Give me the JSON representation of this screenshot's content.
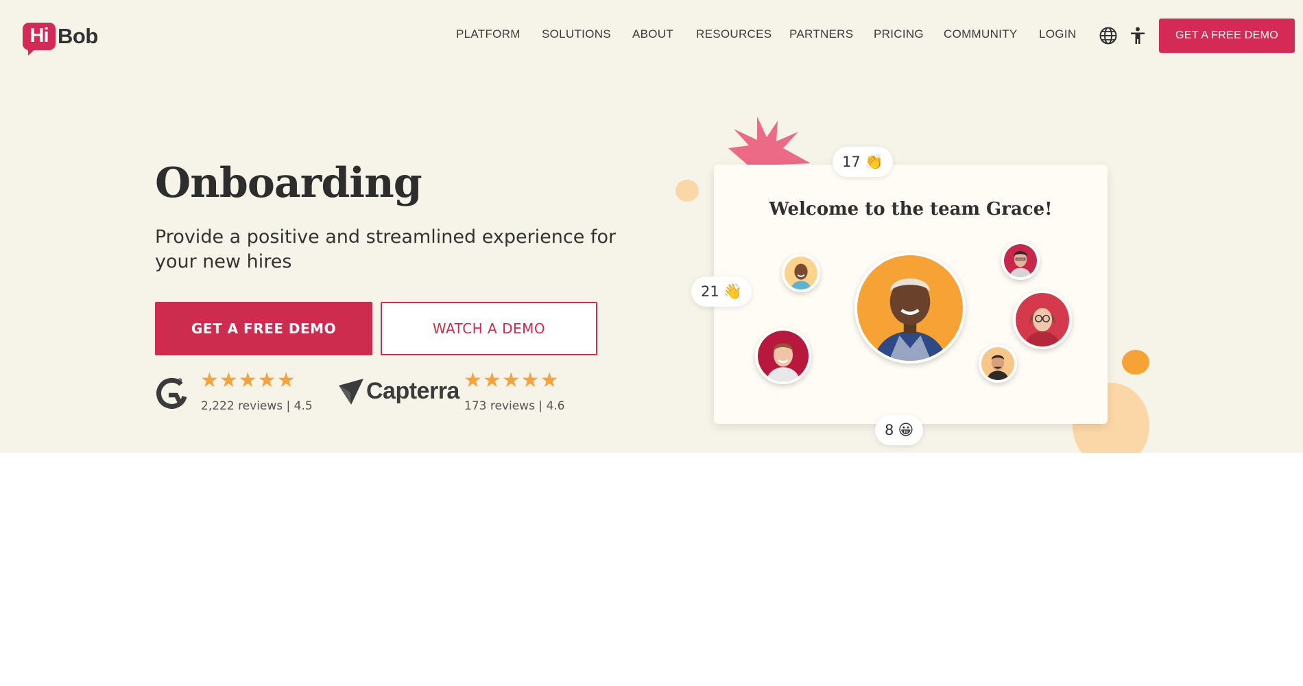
{
  "brand": {
    "logo_hi": "Hi",
    "logo_bob": "Bob"
  },
  "nav": {
    "items": [
      {
        "label": "PLATFORM",
        "name": "nav-platform"
      },
      {
        "label": "SOLUTIONS",
        "name": "nav-solutions"
      },
      {
        "label": "ABOUT",
        "name": "nav-about"
      },
      {
        "label": "RESOURCES",
        "name": "nav-resources"
      },
      {
        "label": "PARTNERS",
        "name": "nav-partners"
      },
      {
        "label": "PRICING",
        "name": "nav-pricing"
      },
      {
        "label": "COMMUNITY",
        "name": "nav-community"
      },
      {
        "label": "LOGIN",
        "name": "nav-login"
      }
    ],
    "icons": [
      "globe-icon",
      "accessibility-icon"
    ],
    "cta_label": "GET A FREE DEMO"
  },
  "hero": {
    "title": "Onboarding",
    "subtitle": "Provide a positive and streamlined experience for your new hires",
    "primary_button": "GET A FREE DEMO",
    "secondary_button": "WATCH A DEMO"
  },
  "reviews": {
    "g2": {
      "logo": "G2",
      "stars": "★★★★★",
      "rating": 4.5,
      "text": "2,222 reviews | 4.5"
    },
    "capterra": {
      "name": "Capterra",
      "stars": "★★★★★",
      "rating": 4.6,
      "text": "173 reviews | 4.6"
    }
  },
  "welcome_card": {
    "title": "Welcome to the team Grace!",
    "reactions": [
      {
        "count": "17",
        "emoji": "👏"
      },
      {
        "count": "21",
        "emoji": "👋"
      },
      {
        "count": "8",
        "emoji": "😀"
      }
    ]
  },
  "colors": {
    "brand_red": "#cd2c4e",
    "hero_bg": "#f6f3e9",
    "star": "#f6a33b",
    "accent_orange": "#f7a234",
    "accent_peach": "#fbd6a6",
    "accent_pink": "#ec6a86"
  }
}
